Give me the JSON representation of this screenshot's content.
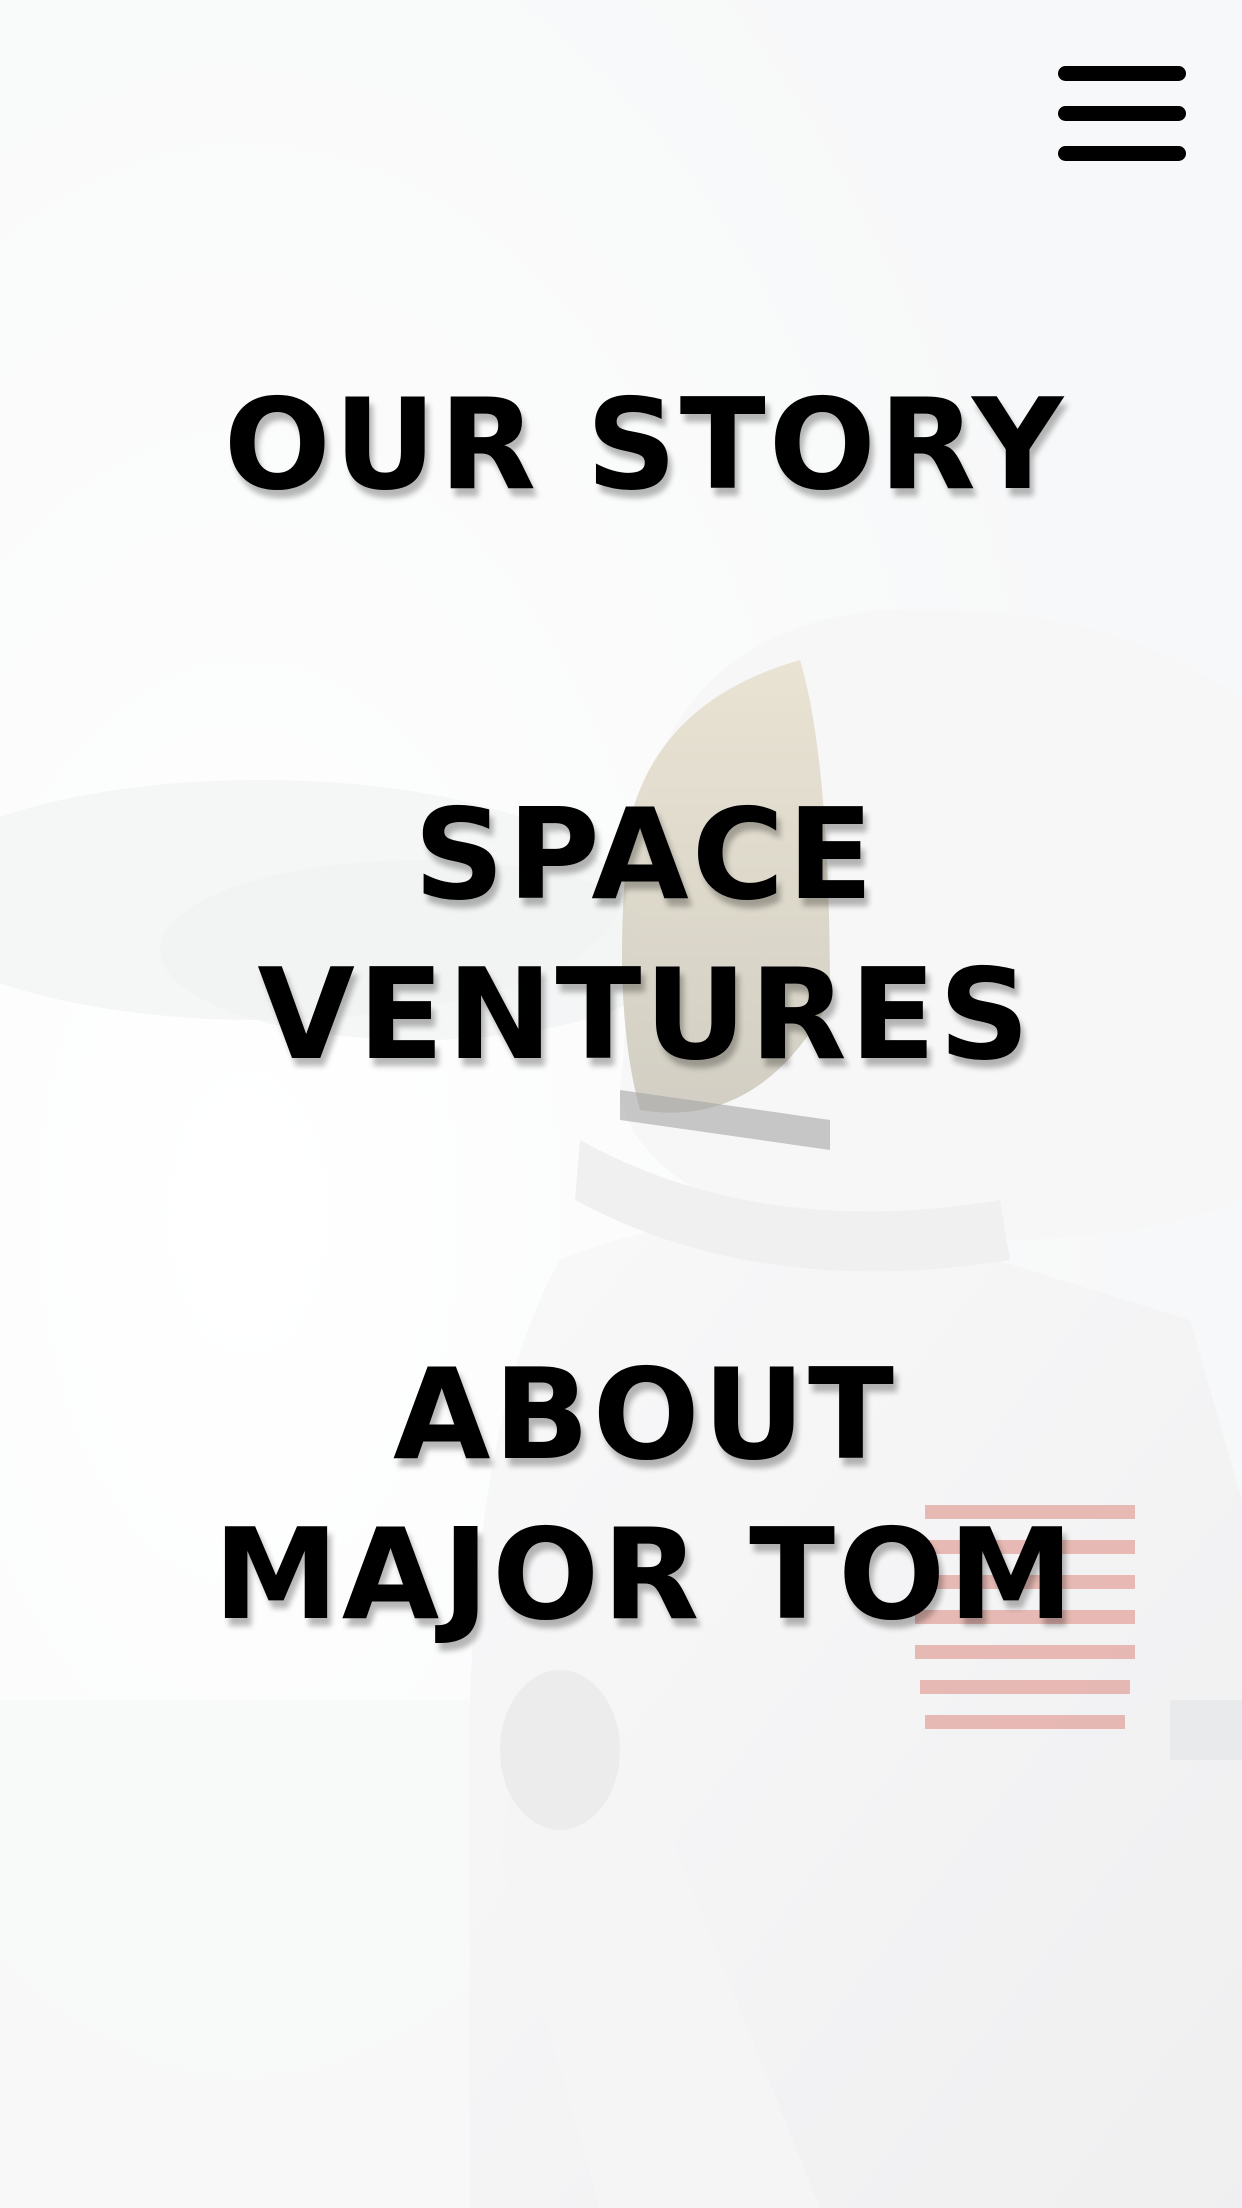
{
  "header": {
    "menu_icon": "hamburger-menu-icon"
  },
  "background": {
    "image": "astronaut-photo",
    "tint_color": "#ffffff"
  },
  "nav": {
    "items": [
      {
        "lines": [
          "OUR STORY"
        ]
      },
      {
        "lines": [
          "SPACE",
          "VENTURES"
        ]
      },
      {
        "lines": [
          "ABOUT",
          "MAJOR TOM"
        ]
      }
    ]
  },
  "colors": {
    "text": "#000000",
    "accent_stripes": "#c0392b"
  }
}
